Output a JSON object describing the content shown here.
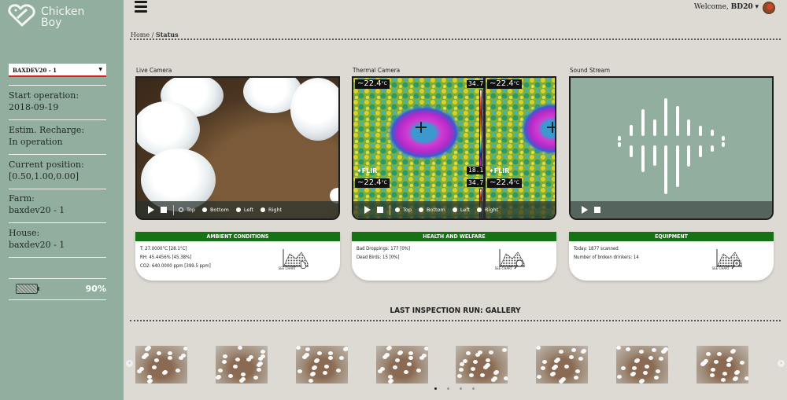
{
  "app": {
    "name_line1": "Chicken",
    "name_line2": "Boy"
  },
  "sidebar": {
    "device_select": {
      "value": "BAXDEV20 - 1"
    },
    "items": [
      {
        "label": "Start operation:",
        "value": "2018-09-19"
      },
      {
        "label": "Estim. Recharge:",
        "value": "In operation"
      },
      {
        "label": "Current position:",
        "value": "[0.50,1.00,0.00]"
      },
      {
        "label": "Farm:",
        "value": "baxdev20 - 1"
      },
      {
        "label": "House:",
        "value": "baxdev20 - 1"
      }
    ],
    "battery": {
      "percent_label": "90%",
      "level": 0.9
    }
  },
  "header": {
    "welcome_prefix": "Welcome,",
    "username": "BD20",
    "dropdown_caret": "▾"
  },
  "breadcrumb": {
    "home": "Home",
    "separator": "/",
    "current": "Status"
  },
  "panels": {
    "live": {
      "title": "Live Camera",
      "views": [
        "Top",
        "Bottom",
        "Left",
        "Right"
      ],
      "selected_view": "Top"
    },
    "thermal": {
      "title": "Thermal Camera",
      "spot_temp": "~22.4",
      "unit": "°C",
      "scale_max": "34.7",
      "scale_min": "18.1",
      "brand": "FLIR",
      "views": [
        "Top",
        "Bottom",
        "Left",
        "Right"
      ],
      "selected_view": "Top"
    },
    "sound": {
      "title": "Sound Stream"
    }
  },
  "cards": [
    {
      "title": "AMBIENT CONDITIONS",
      "lines": [
        "T: 27.0000°C [28.1°C]",
        "RH: 45.4456% [45.38%]",
        "CO2: 640.0000 ppm [399.5 ppm]"
      ],
      "link": "SEE CHART"
    },
    {
      "title": "HEALTH AND WELFARE",
      "lines": [
        "Bad Droppings: 177 [0%]",
        "Dead Birds: 15 [0%]"
      ],
      "link": "SEE CHART"
    },
    {
      "title": "EQUIPMENT",
      "lines": [
        "Today: 1877 scanned",
        "Number of broken drinkers: 14"
      ],
      "link": "SEE CHART"
    }
  ],
  "gallery": {
    "title": "LAST INSPECTION RUN: GALLERY",
    "image_count": 8,
    "pages": 4,
    "active_page": 1
  },
  "colors": {
    "sidebar_bg": "#91ae9f",
    "card_header": "#157315",
    "select_underline": "#d92020",
    "page_bg": "#dddad3"
  }
}
